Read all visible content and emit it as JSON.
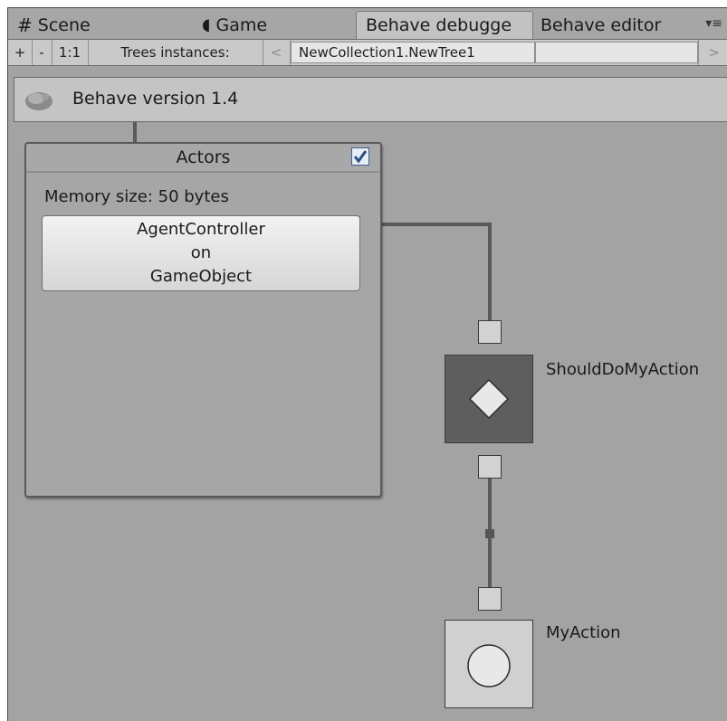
{
  "tabs": [
    {
      "icon": "#",
      "label": "Scene",
      "active": false
    },
    {
      "icon": "◖",
      "label": "Game",
      "active": false
    },
    {
      "label": "Behave debugge",
      "active": true
    },
    {
      "label": "Behave editor",
      "active": false
    }
  ],
  "tab_menu_glyph": "▾≡",
  "toolbar": {
    "plus": "+",
    "minus": "-",
    "zoom": "1:1",
    "trees_label": "Trees instances:",
    "prev": "<",
    "tree_name": "NewCollection1.NewTree1",
    "next": ">"
  },
  "header": {
    "title": "Behave version 1.4"
  },
  "actors_panel": {
    "title": "Actors",
    "checked": true,
    "memory": "Memory size: 50 bytes",
    "agent_line1": "AgentController",
    "agent_line2": "on",
    "agent_line3": "GameObject"
  },
  "graph": {
    "decorator_label": "ShouldDoMyAction",
    "action_label": "MyAction"
  },
  "colors": {
    "canvas": "#a3a3a3",
    "decorator_fill": "#5e5e5e",
    "action_fill": "#d0d0d0",
    "wire": "#5a5a5a",
    "checkbox_tick": "#2b4f86"
  }
}
